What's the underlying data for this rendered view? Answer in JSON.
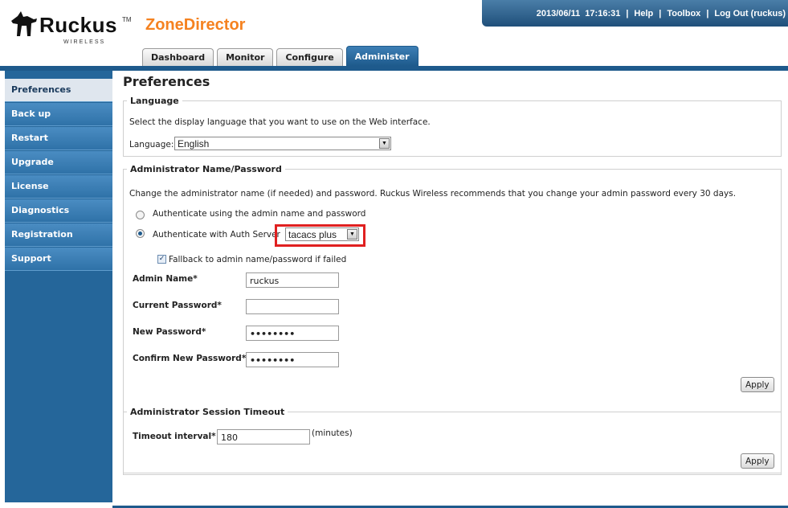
{
  "brand": {
    "logo_word": "Ruckus",
    "logo_tm": "TM",
    "logo_sub": "WIRELESS",
    "product": "ZoneDirector"
  },
  "topbar": {
    "datetime": "2013/06/11  17:16:31",
    "help": "Help",
    "toolbox": "Toolbox",
    "logout": "Log Out (ruckus)",
    "separator": "|"
  },
  "tabs": [
    {
      "label": "Dashboard",
      "active": false
    },
    {
      "label": "Monitor",
      "active": false
    },
    {
      "label": "Configure",
      "active": false
    },
    {
      "label": "Administer",
      "active": true
    }
  ],
  "sidebar": {
    "items": [
      {
        "label": "Preferences",
        "active": true
      },
      {
        "label": "Back up"
      },
      {
        "label": "Restart"
      },
      {
        "label": "Upgrade"
      },
      {
        "label": "License"
      },
      {
        "label": "Diagnostics"
      },
      {
        "label": "Registration"
      },
      {
        "label": "Support"
      }
    ]
  },
  "page": {
    "title": "Preferences"
  },
  "language": {
    "legend": "Language",
    "description": "Select the display language that you want to use on the Web interface.",
    "label": "Language:",
    "value": "English"
  },
  "admin": {
    "legend": "Administrator Name/Password",
    "description": "Change the administrator name (if needed) and password. Ruckus Wireless recommends that you change your admin password every 30 days.",
    "radio_local": "Authenticate using the admin name and password",
    "radio_server": "Authenticate with Auth Server",
    "auth_server_value": "tacacs plus",
    "fallback_label": "Fallback to admin name/password if failed",
    "fallback_checked": true,
    "admin_name_label": "Admin Name*",
    "admin_name_value": "ruckus",
    "current_password_label": "Current Password*",
    "current_password_value": "",
    "new_password_label": "New Password*",
    "new_password_value": "••••••••",
    "confirm_password_label": "Confirm New Password*",
    "confirm_password_value": "••••••••",
    "apply": "Apply"
  },
  "session": {
    "legend": "Administrator Session Timeout",
    "timeout_label": "Timeout interval*",
    "timeout_value": "180",
    "unit": "(minutes)",
    "apply": "Apply"
  },
  "colors": {
    "brand_orange": "#f58220",
    "nav_blue": "#25669a",
    "highlight_red": "#e02020"
  }
}
